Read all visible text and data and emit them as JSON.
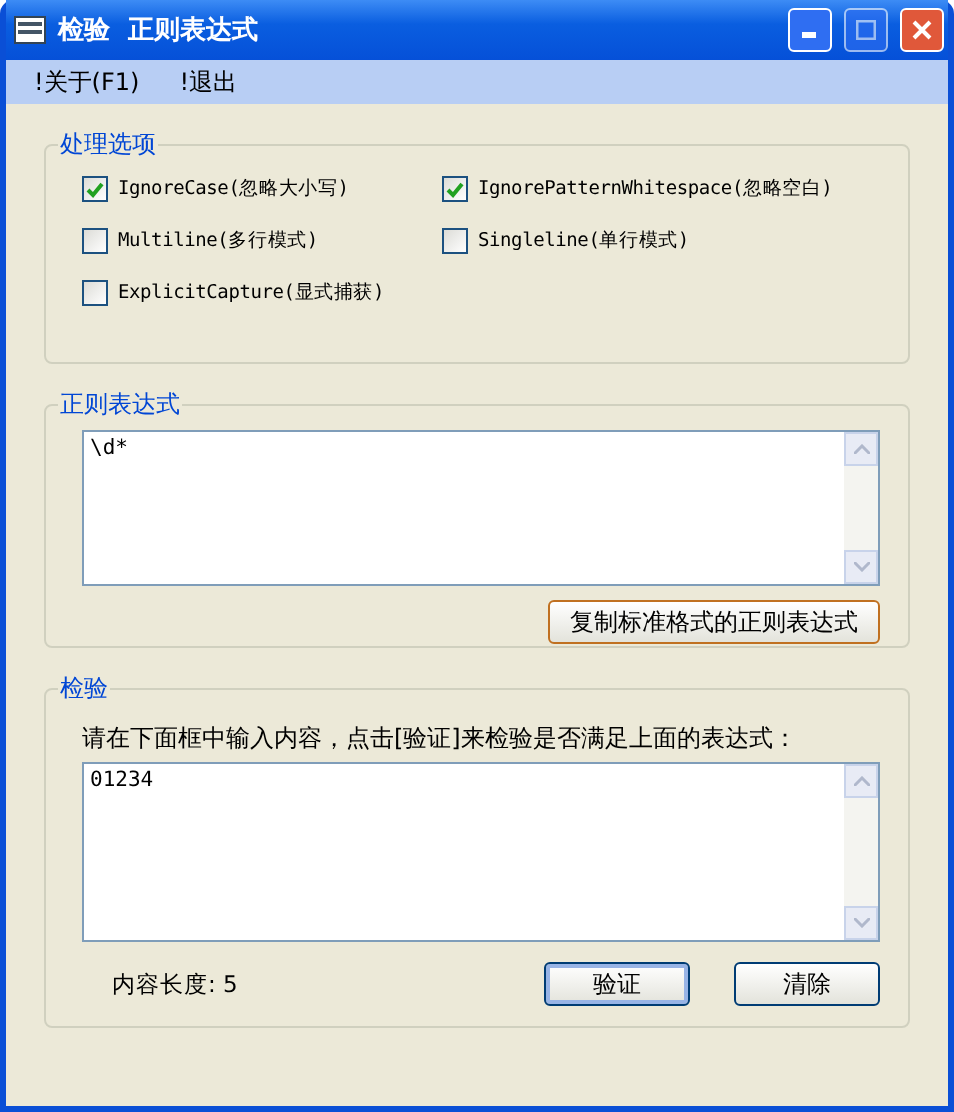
{
  "window": {
    "title": "检验  正则表达式"
  },
  "menu": [
    "!关于(F1)",
    "!退出"
  ],
  "options": {
    "title": "处理选项",
    "items": [
      {
        "label": "IgnoreCase(忽略大小写)",
        "checked": true
      },
      {
        "label": "IgnorePatternWhitespace(忽略空白)",
        "checked": true
      },
      {
        "label": "Multiline(多行模式)",
        "checked": false
      },
      {
        "label": "Singleline(单行模式)",
        "checked": false
      },
      {
        "label": "ExplicitCapture(显式捕获)",
        "checked": false
      }
    ]
  },
  "regex": {
    "title": "正则表达式",
    "value": "\\d*",
    "copy_button": "复制标准格式的正则表达式"
  },
  "test": {
    "title": "检验",
    "instruction": "请在下面框中输入内容，点击[验证]来检验是否满足上面的表达式：",
    "value": "01234",
    "length_label": "内容长度: 5",
    "verify_button": "验证",
    "clear_button": "清除"
  }
}
